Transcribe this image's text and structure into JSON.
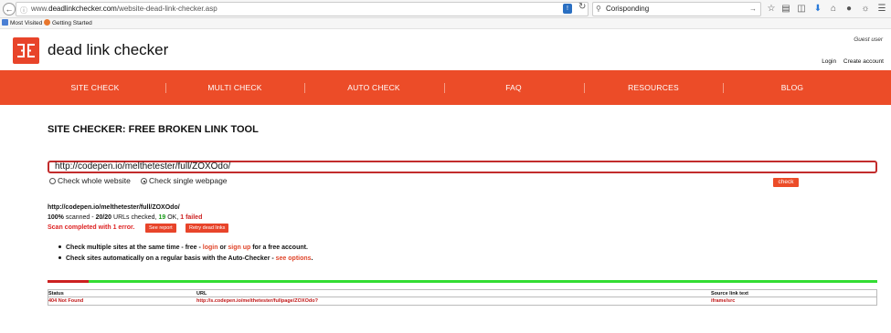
{
  "browser": {
    "url_prefix": "www.",
    "url_domain": "deadlinkchecker.com",
    "url_path": "/website-dead-link-checker.asp",
    "search_value": "Corisponding",
    "bookmarks": [
      {
        "label": "Most Visited",
        "color": "#4a7fd4"
      },
      {
        "label": "Getting Started",
        "color": "#e8762c"
      }
    ]
  },
  "header": {
    "logo_text": "dead link checker",
    "guest_label": "Guest user",
    "login_label": "Login",
    "create_account_label": "Create account"
  },
  "nav": {
    "items": [
      "SITE CHECK",
      "MULTI CHECK",
      "AUTO CHECK",
      "FAQ",
      "RESOURCES",
      "BLOG"
    ]
  },
  "main": {
    "title": "SITE CHECKER: FREE BROKEN LINK TOOL",
    "url_value": "http://codepen.io/melthetester/full/ZOXOdo/",
    "radio_whole": "Check whole website",
    "radio_single": "Check single webpage",
    "selected_mode": "single",
    "check_label": "check"
  },
  "results": {
    "checked_url": "http://codepen.io/melthetester/full/ZOXOdo/",
    "percent": "100%",
    "scanned_label": "scanned -",
    "urls_checked": "20/20",
    "urls_checked_label": "URLs checked,",
    "ok_count": "19",
    "ok_label": "OK,",
    "failed": "1 failed",
    "error_message": "Scan completed with 1 error.",
    "see_report_label": "See report",
    "retry_label": "Retry dead links",
    "failed_fraction": 0.05
  },
  "tips": {
    "tip1_start": "Check multiple sites at the same time - free - ",
    "tip1_login": "login",
    "tip1_or": " or ",
    "tip1_signup": "sign up",
    "tip1_end": " for a free account.",
    "tip2_start": "Check sites automatically on a regular basis with the Auto-Checker - ",
    "tip2_link": "see options",
    "tip2_end": "."
  },
  "table": {
    "headers": [
      "Status",
      "URL",
      "Source link text"
    ],
    "rows": [
      [
        "404 Not Found",
        "http://s.codepen.io/melthetester/fullpage/ZOXOdo?",
        "iframe/src"
      ]
    ]
  },
  "colors": {
    "brand_orange": "#ec4c28",
    "error_red": "#c22c2c",
    "ok_green": "#33dd33"
  }
}
